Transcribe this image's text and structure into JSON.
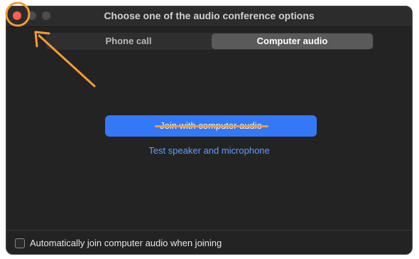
{
  "window": {
    "title": "Choose one of the audio conference options"
  },
  "tabs": [
    {
      "label": "Phone call",
      "selected": false
    },
    {
      "label": "Computer audio",
      "selected": true
    }
  ],
  "main": {
    "join_button_label": "Join with computer audio",
    "test_link_label": "Test speaker and microphone"
  },
  "footer": {
    "auto_join_label": "Automatically join computer audio when joining",
    "auto_join_checked": false
  },
  "colors": {
    "accent_blue": "#3478f6",
    "link_blue": "#5aa0ff",
    "annotation_orange": "#f39c34",
    "close_red": "#ff5f57"
  },
  "icons": {
    "close": "close-icon",
    "minimize": "minimize-icon",
    "maximize": "maximize-icon"
  }
}
